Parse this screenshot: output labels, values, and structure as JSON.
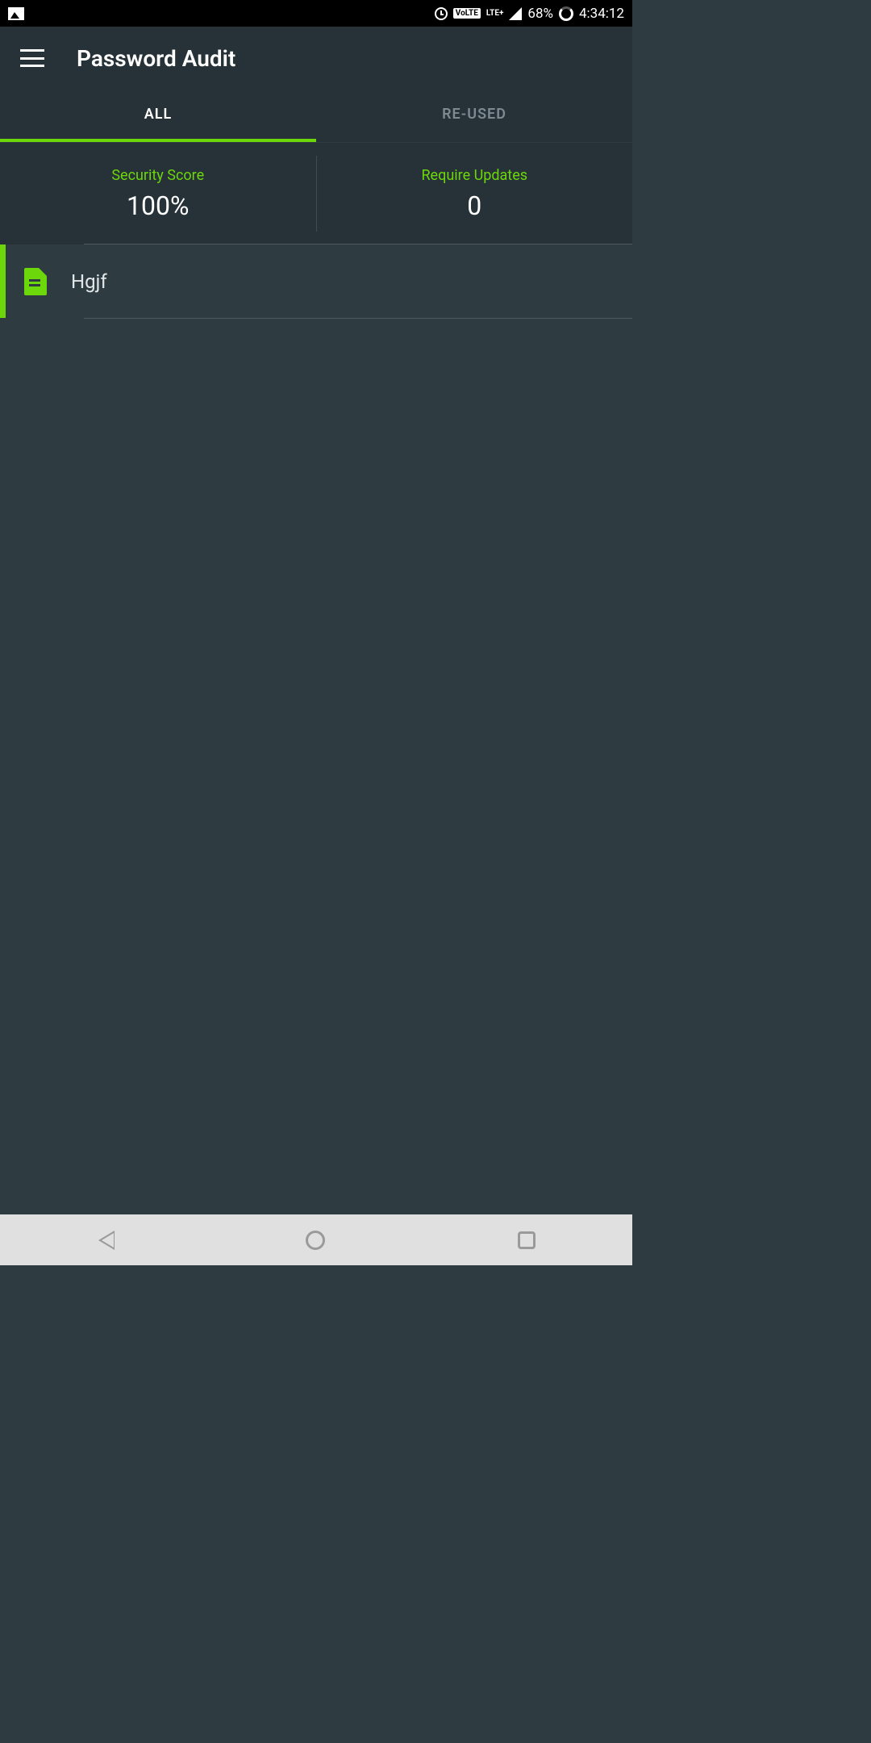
{
  "status_bar": {
    "volte": "VoLTE",
    "lte": "LTE+",
    "battery": "68%",
    "time": "4:34:12"
  },
  "header": {
    "title": "Password Audit"
  },
  "tabs": {
    "all": "ALL",
    "reused": "RE-USED"
  },
  "stats": {
    "security_label": "Security Score",
    "security_value": "100%",
    "updates_label": "Require Updates",
    "updates_value": "0"
  },
  "items": [
    {
      "name": "Hgjf"
    }
  ]
}
